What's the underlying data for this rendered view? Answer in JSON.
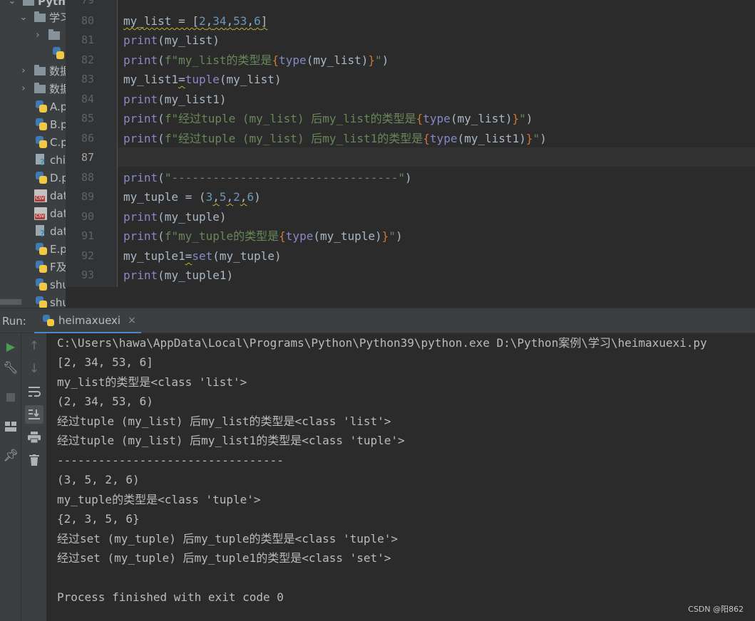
{
  "project_tree": {
    "items": [
      {
        "label": "Pytho",
        "kind": "folder",
        "expanded": true
      },
      {
        "label": "学习",
        "kind": "folder",
        "expanded": true
      },
      {
        "label": "",
        "kind": "folder",
        "expanded": false
      },
      {
        "label": "",
        "kind": "python-file"
      },
      {
        "label": "数据",
        "kind": "folder",
        "expanded": false
      },
      {
        "label": "数据",
        "kind": "folder",
        "expanded": false
      },
      {
        "label": "A.p",
        "kind": "python-file"
      },
      {
        "label": "B.p",
        "kind": "python-file"
      },
      {
        "label": "C.p",
        "kind": "python-file"
      },
      {
        "label": "chi",
        "kind": "unknown-file"
      },
      {
        "label": "D.p",
        "kind": "python-file"
      },
      {
        "label": "dat",
        "kind": "csv-file"
      },
      {
        "label": "dat",
        "kind": "csv-file"
      },
      {
        "label": "dat",
        "kind": "unknown-file"
      },
      {
        "label": "E.p",
        "kind": "python-file"
      },
      {
        "label": "F及",
        "kind": "python-file"
      },
      {
        "label": "shu",
        "kind": "python-file"
      },
      {
        "label": "shu",
        "kind": "python-file"
      }
    ]
  },
  "editor": {
    "top_line_number": "79",
    "line_numbers": [
      "80",
      "81",
      "82",
      "83",
      "84",
      "85",
      "86",
      "87",
      "88",
      "89",
      "90",
      "91",
      "92",
      "93"
    ],
    "current_line": "87"
  },
  "run": {
    "panel_label": "Run:",
    "tab_label": "heimaxuexi",
    "close_glyph": "×",
    "toolbar_icons": [
      "run-icon",
      "wrench-icon",
      "stop-icon",
      "layout-icon",
      "pin-icon",
      "up-arrow-icon",
      "down-arrow-icon",
      "soft-wrap-icon",
      "scroll-to-end-icon",
      "print-icon",
      "trash-icon"
    ],
    "output": [
      "C:\\Users\\hawa\\AppData\\Local\\Programs\\Python\\Python39\\python.exe D:\\Python案例\\学习\\heimaxuexi.py",
      "[2, 34, 53, 6]",
      "my_list的类型是<class 'list'>",
      "(2, 34, 53, 6)",
      "经过tuple (my_list) 后my_list的类型是<class 'list'>",
      "经过tuple (my_list) 后my_list1的类型是<class 'tuple'>",
      "---------------------------------",
      "(3, 5, 2, 6)",
      "my_tuple的类型是<class 'tuple'>",
      "{2, 3, 5, 6}",
      "经过set (my_tuple) 后my_tuple的类型是<class 'tuple'>",
      "经过set (my_tuple) 后my_tuple1的类型是<class 'set'>",
      "",
      "Process finished with exit code 0"
    ]
  },
  "watermark": "CSDN @阳862",
  "colors": {
    "keyword": "#8888c6",
    "string": "#6a8759",
    "brace": "#cc7832",
    "number": "#6897bb",
    "run_green": "#499c54"
  }
}
